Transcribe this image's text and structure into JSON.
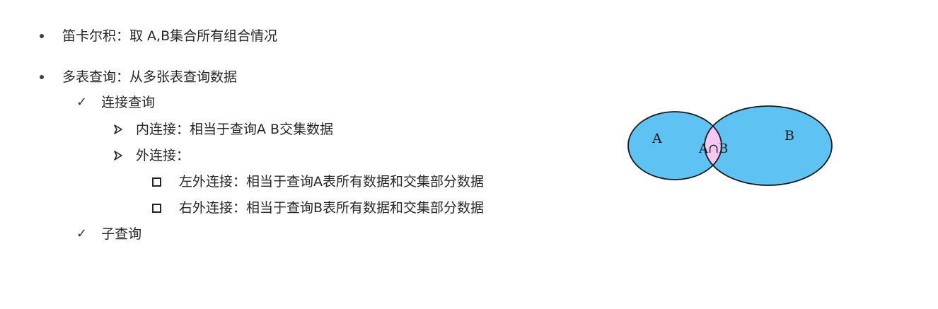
{
  "items": {
    "cartesian": "笛卡尔积：取 A,B集合所有组合情况",
    "multi_table": "多表查询：从多张表查询数据",
    "join_query": "连接查询",
    "inner_join": "内连接：相当于查询A B交集数据",
    "outer_join": "外连接：",
    "left_outer": "左外连接：相当于查询A表所有数据和交集部分数据",
    "right_outer": "右外连接：相当于查询B表所有数据和交集部分数据",
    "subquery": "子查询"
  },
  "venn": {
    "label_a": "A",
    "label_b": "B",
    "label_intersection": "A∩B",
    "colors": {
      "fill": "#5ec2f2",
      "intersection": "#f5c8f3",
      "stroke": "#1a1a1a"
    }
  },
  "icons": {
    "bullet": "bullet-dot-icon",
    "check": "checkmark-icon",
    "arrow": "arrow-right-icon",
    "square": "hollow-square-icon"
  }
}
